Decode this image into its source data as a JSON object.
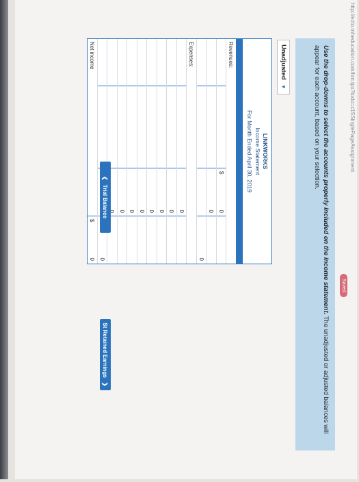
{
  "browser": {
    "url_fragment": "http://ezto.mheducation.com/hm.tpx?todo=c15SinglePageAssignment"
  },
  "status": {
    "saved": "Saved"
  },
  "instructions": {
    "bold": "Use the drop-downs to select the accounts properly included on the income statement.",
    "rest": " The unadjusted or adjusted balances will appear for each account, based on your selection."
  },
  "balance_select": {
    "value": "Unadjusted"
  },
  "statement": {
    "company": "LINKWORKS",
    "title": "Income Statement",
    "period": "For Month Ended April 30, 2019",
    "revenues_label": "Revenues:",
    "expenses_label": "Expenses:",
    "net_income_label": "Net income",
    "currency": "$",
    "revenue_values": [
      "0",
      "0"
    ],
    "revenue_total": "0",
    "expense_values": [
      "0",
      "0",
      "0",
      "0",
      "0",
      "0",
      "0",
      "0"
    ],
    "expense_total": "0",
    "net_income_value": "0"
  },
  "nav": {
    "prev_label": "Trial Balance",
    "next_label": "St Retained Earnings"
  }
}
